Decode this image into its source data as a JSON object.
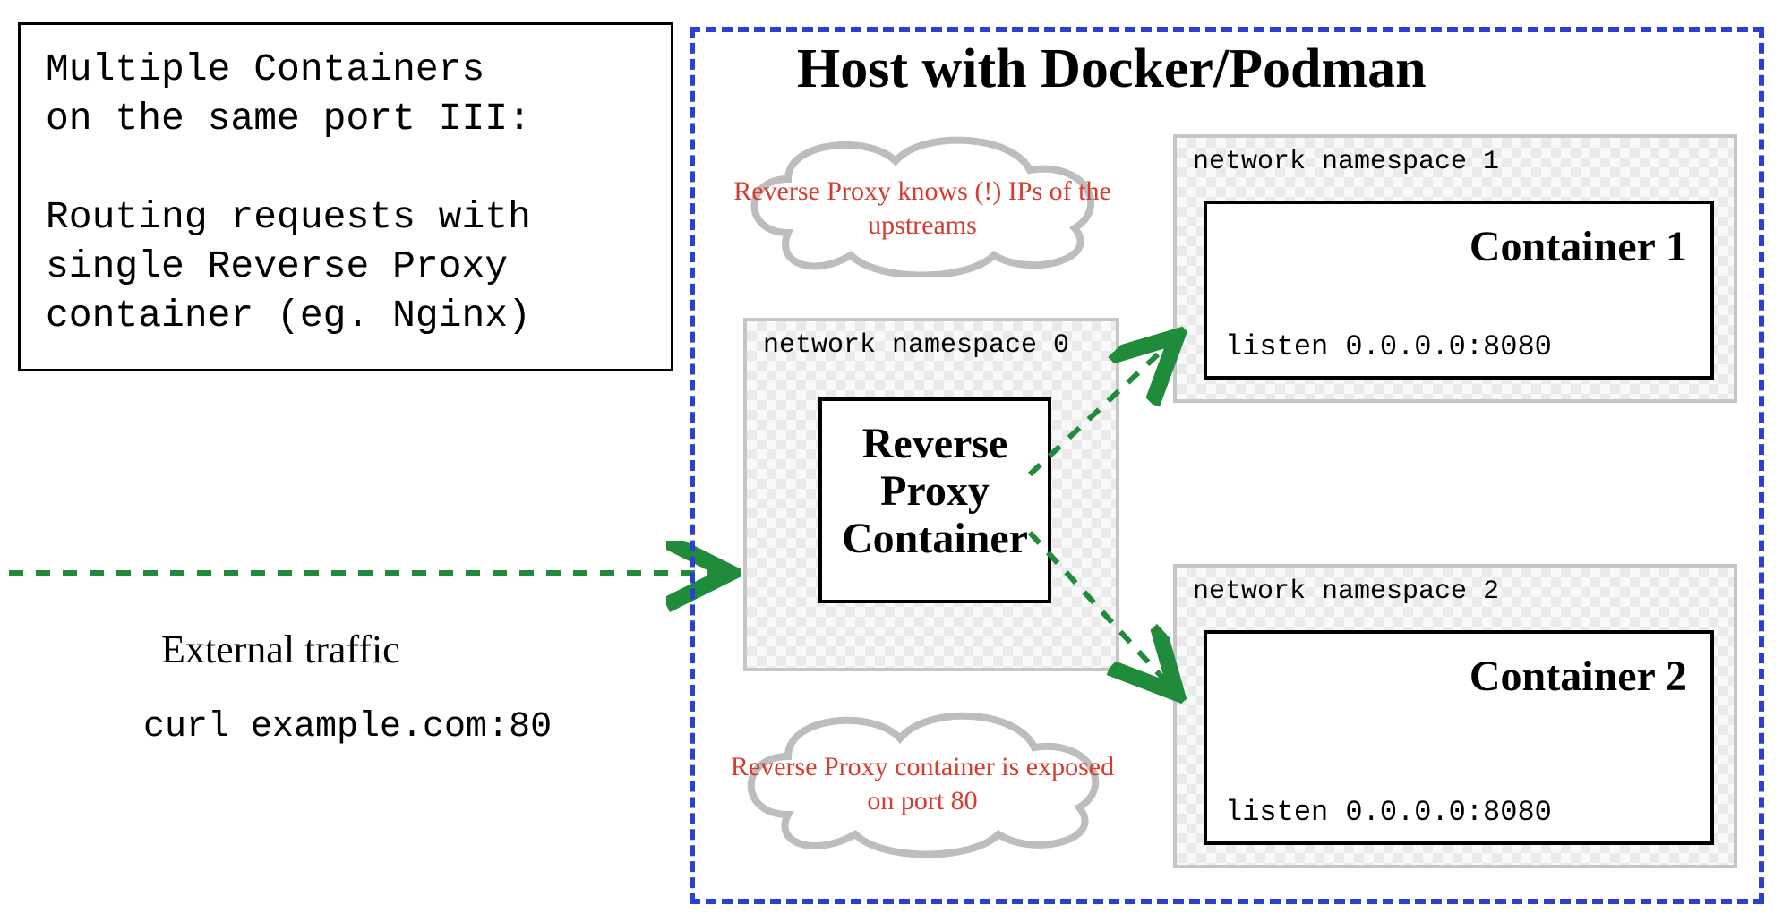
{
  "title": {
    "line1": "Multiple Containers",
    "line2": "on the same port III:",
    "line3": "",
    "line4": "Routing requests with",
    "line5": "single Reverse Proxy",
    "line6": "container (eg. Nginx)"
  },
  "external": {
    "label": "External traffic",
    "command": "curl example.com:80"
  },
  "host": {
    "title": "Host with Docker/Podman"
  },
  "clouds": {
    "top": "Reverse Proxy knows (!) IPs of the upstreams",
    "bottom": "Reverse Proxy container is exposed on port 80"
  },
  "ns0": {
    "label": "network namespace 0",
    "container_line1": "Reverse",
    "container_line2": "Proxy",
    "container_line3": "Container"
  },
  "ns1": {
    "label": "network namespace 1",
    "container": "Container 1",
    "listen": "listen 0.0.0.0:8080"
  },
  "ns2": {
    "label": "network namespace 2",
    "container": "Container 2",
    "listen": "listen 0.0.0.0:8080"
  }
}
